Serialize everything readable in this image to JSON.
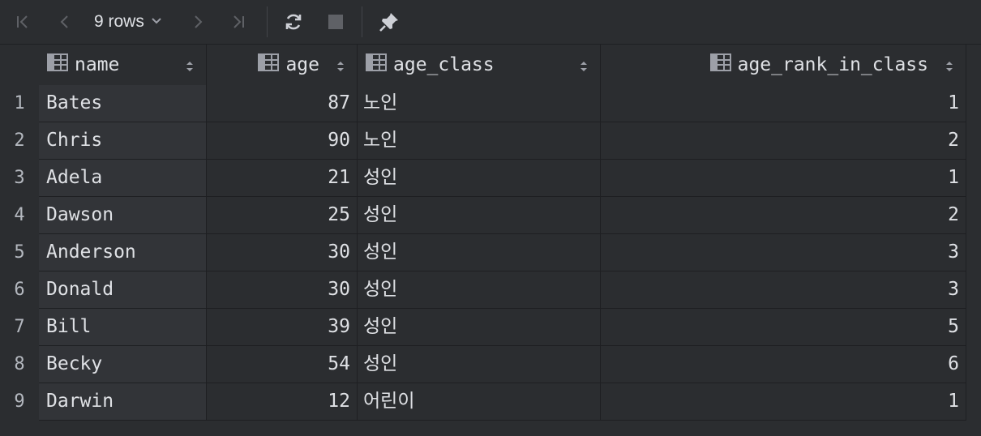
{
  "toolbar": {
    "rows_label": "9 rows",
    "icons": [
      "first-page-icon",
      "previous-page-icon",
      "next-page-icon",
      "last-page-icon",
      "refresh-icon",
      "stop-icon",
      "pin-icon"
    ]
  },
  "columns": [
    {
      "label": "name"
    },
    {
      "label": "age"
    },
    {
      "label": "age_class"
    },
    {
      "label": "age_rank_in_class"
    }
  ],
  "rows": [
    {
      "num": "1",
      "name": "Bates",
      "age": "87",
      "age_class": "노인",
      "rank": "1"
    },
    {
      "num": "2",
      "name": "Chris",
      "age": "90",
      "age_class": "노인",
      "rank": "2"
    },
    {
      "num": "3",
      "name": "Adela",
      "age": "21",
      "age_class": "성인",
      "rank": "1"
    },
    {
      "num": "4",
      "name": "Dawson",
      "age": "25",
      "age_class": "성인",
      "rank": "2"
    },
    {
      "num": "5",
      "name": "Anderson",
      "age": "30",
      "age_class": "성인",
      "rank": "3"
    },
    {
      "num": "6",
      "name": "Donald",
      "age": "30",
      "age_class": "성인",
      "rank": "3"
    },
    {
      "num": "7",
      "name": "Bill",
      "age": "39",
      "age_class": "성인",
      "rank": "5"
    },
    {
      "num": "8",
      "name": "Becky",
      "age": "54",
      "age_class": "성인",
      "rank": "6"
    },
    {
      "num": "9",
      "name": "Darwin",
      "age": "12",
      "age_class": "어린이",
      "rank": "1"
    }
  ]
}
